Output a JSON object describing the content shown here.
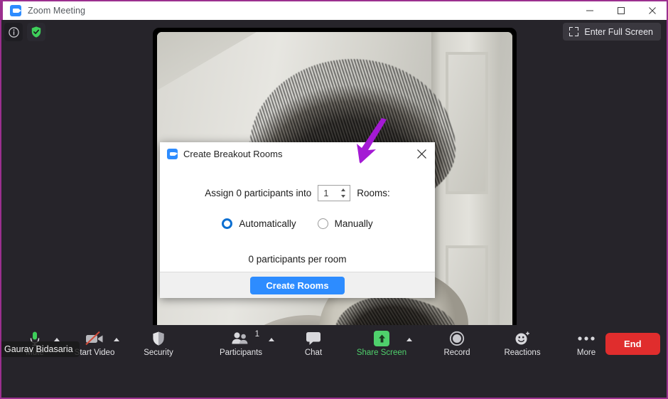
{
  "window": {
    "title": "Zoom Meeting",
    "app_icon": "zoom-camera-icon",
    "controls": {
      "minimize": "minimize-icon",
      "maximize": "maximize-icon",
      "close": "close-icon"
    },
    "border_color": "#9b2f8f"
  },
  "meeting": {
    "status_icons": {
      "info": "info-icon",
      "security_shield": "green-shield-check-icon"
    },
    "fullscreen_button": {
      "label": "Enter Full Screen",
      "icon": "expand-corners-icon"
    },
    "active_speaker_name": "Gaurav Bidasaria"
  },
  "dialog": {
    "icon": "zoom-camera-icon",
    "title": "Create Breakout Rooms",
    "close_icon": "close-icon",
    "assign_prefix": "Assign 0 participants into",
    "rooms_count_value": "1",
    "assign_suffix": "Rooms:",
    "spinner_up_icon": "spinner-up-icon",
    "spinner_down_icon": "spinner-down-icon",
    "options": [
      {
        "label": "Automatically",
        "selected": true
      },
      {
        "label": "Manually",
        "selected": false
      }
    ],
    "per_room_text": "0 participants per room",
    "primary_button": "Create Rooms",
    "primary_color": "#2d8cff"
  },
  "annotation": {
    "arrow": "purple-down-left-arrow",
    "color": "#a41ad4"
  },
  "toolbar": {
    "items": [
      {
        "label": "Mute",
        "icon": "microphone-icon",
        "caret": true,
        "green_label": false
      },
      {
        "label": "Start Video",
        "icon": "video-off-icon",
        "caret": true,
        "green_label": false
      },
      {
        "label": "Security",
        "icon": "shield-icon",
        "caret": false,
        "green_label": false
      },
      {
        "label": "Participants",
        "icon": "participants-icon",
        "caret": true,
        "green_label": false,
        "badge": "1"
      },
      {
        "label": "Chat",
        "icon": "chat-bubble-icon",
        "caret": false,
        "green_label": false
      },
      {
        "label": "Share Screen",
        "icon": "share-screen-icon",
        "caret": true,
        "green_label": true
      },
      {
        "label": "Record",
        "icon": "record-circle-icon",
        "caret": false,
        "green_label": false
      },
      {
        "label": "Reactions",
        "icon": "reactions-smiley-icon",
        "caret": false,
        "green_label": false
      },
      {
        "label": "More",
        "icon": "more-dots-icon",
        "caret": false,
        "green_label": false
      }
    ],
    "end_button": {
      "label": "End",
      "color": "#e02d2d"
    }
  }
}
